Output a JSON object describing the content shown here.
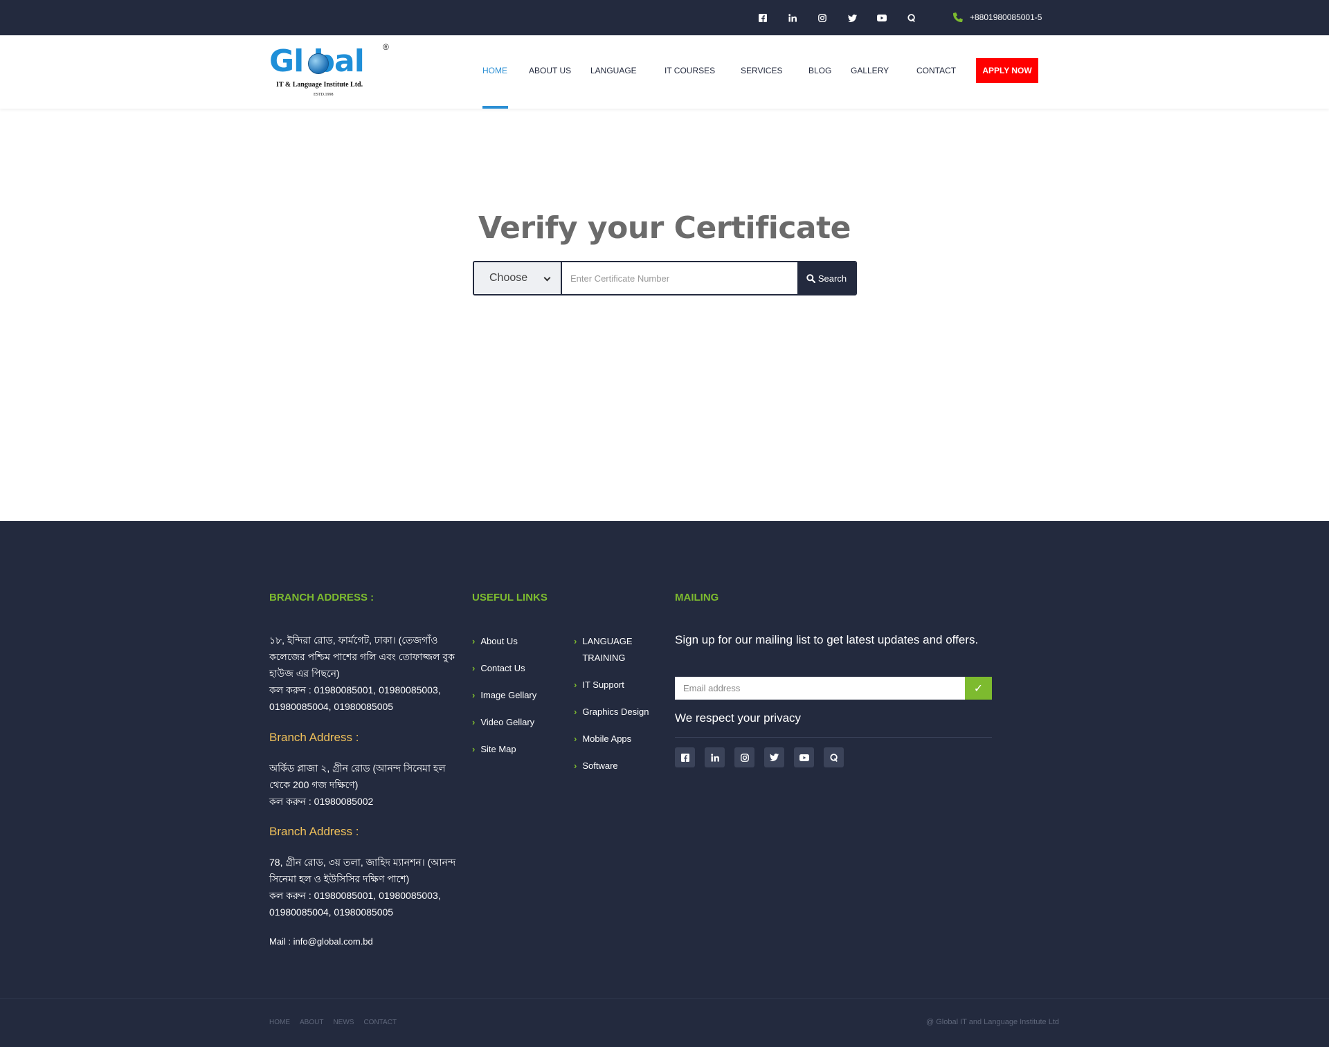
{
  "topbar": {
    "social_icons": [
      "facebook-icon",
      "linkedin-icon",
      "instagram-icon",
      "twitter-icon",
      "youtube-icon",
      "quora-icon"
    ],
    "phone": "+8801980085001-5"
  },
  "header": {
    "logo": {
      "word": "Gl bal",
      "registered": "®",
      "tagline": "IT & Language Institute Ltd.",
      "estd": "ESTD.1998"
    },
    "nav": [
      {
        "label": "HOME",
        "active": true
      },
      {
        "label": "ABOUT US"
      },
      {
        "label": "LANGUAGE"
      },
      {
        "label": "IT COURSES"
      },
      {
        "label": "SERVICES"
      },
      {
        "label": "BLOG"
      },
      {
        "label": "GALLERY"
      },
      {
        "label": "CONTACT"
      }
    ],
    "apply_label": "APPLY NOW"
  },
  "verify": {
    "title": "Verify your Certificate",
    "choose_label": "Choose",
    "input_placeholder": "Enter Certificate Number",
    "search_label": "Search"
  },
  "footer": {
    "branch_title": "BRANCH ADDRESS :",
    "branch1": {
      "address": "১৮, ইন্দিরা রোড, ফার্মগেট, ঢাকা। (তেজগাঁও কলেজের পশ্চিম পাশের গলি এবং তোফাজ্জল বুক হাউজ এর পিছনে)",
      "phones": "কল করুন : 01980085001, 01980085003, 01980085004, 01980085005"
    },
    "branch2": {
      "heading": "Branch Address :",
      "address": "অর্কিড প্লাজা ২, গ্রীন রোড (আনন্দ সিনেমা হল থেকে 200 গজ দক্ষিণে)",
      "phones": "কল করুন : 01980085002"
    },
    "branch3": {
      "heading": "Branch Address :",
      "address": "78, গ্রীন রোড, ৩য় তলা, জাহিদ ম্যানশন। (আনন্দ সিনেমা হল ও ইউসিসির দক্ষিণ পাশে)",
      "phones": "কল করুন : 01980085001, 01980085003, 01980085004, 01980085005"
    },
    "mail": "Mail : info@global.com.bd",
    "useful_title": "USEFUL LINKS",
    "links_col1": [
      "About Us",
      "Contact Us",
      "Image Gellary",
      "Video Gellary",
      "Site Map"
    ],
    "links_col2": [
      "LANGUAGE TRAINING",
      "IT Support",
      "Graphics Design",
      "Mobile Apps",
      "Software"
    ],
    "mailing_title": "MAILING",
    "mailing_text": "Sign up for our mailing list to get latest updates and offers.",
    "email_placeholder": "Email address",
    "submit_glyph": "✓",
    "privacy": "We respect your privacy",
    "social_icons": [
      "facebook-icon",
      "linkedin-icon",
      "instagram-icon",
      "twitter-icon",
      "youtube-icon",
      "quora-icon"
    ],
    "bottom_links": [
      "HOME",
      "ABOUT",
      "NEWS",
      "CONTACT"
    ],
    "copyright": "@ Global IT and Language Institute Ltd"
  },
  "colors": {
    "navy": "#232a3e",
    "accent_blue": "#2b8fd4",
    "apply_red": "#ff0000",
    "footer_green": "#7dbb2f",
    "branch_yellow": "#f0c15a"
  }
}
